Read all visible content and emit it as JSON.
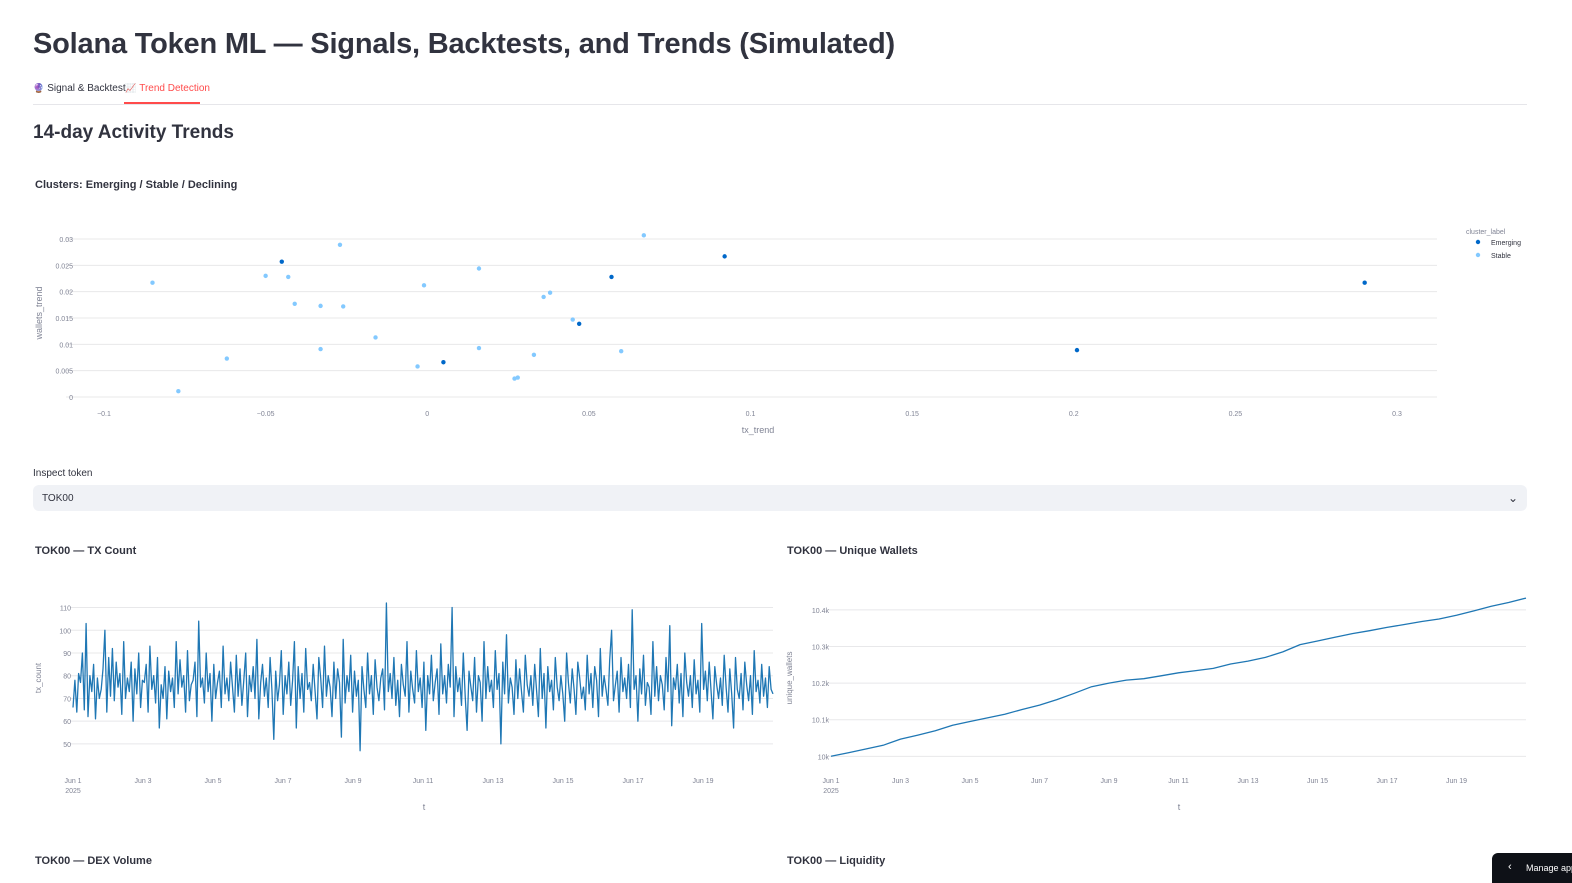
{
  "app": {
    "title": "Solana Token ML — Signals, Backtests, and Trends (Simulated)"
  },
  "tabs": [
    {
      "label": "Signal & Backtest",
      "icon": "crystal-ball-icon",
      "icon_glyph": "🔮"
    },
    {
      "label": "Trend Detection",
      "icon": "chart-increasing-icon",
      "icon_glyph": "📈"
    }
  ],
  "section": {
    "heading": "14-day Activity Trends"
  },
  "colors": {
    "accent": "#ff4b4b",
    "emerging": "#0068c9",
    "stable": "#83c9ff",
    "line": "#1f77b4",
    "grid": "#e8e8ea",
    "axis_text": "#808495"
  },
  "scatter": {
    "title": "Clusters: Emerging / Stable / Declining",
    "legend_title": "cluster_label"
  },
  "inspect": {
    "label": "Inspect token",
    "selected": "TOK00"
  },
  "charts": {
    "tx_title": "TOK00 — TX Count",
    "wallets_title": "TOK00 — Unique Wallets",
    "dex_title": "TOK00 — DEX Volume",
    "liq_title": "TOK00 — Liquidity"
  },
  "manage_app": {
    "label": "Manage app"
  },
  "chart_data": [
    {
      "type": "scatter",
      "title": "Clusters: Emerging / Stable / Declining",
      "xlabel": "tx_trend",
      "ylabel": "wallets_trend",
      "xlim": [
        -0.1,
        0.3
      ],
      "ylim": [
        0,
        0.03
      ],
      "xticks": [
        "−0.1",
        "−0.05",
        "0",
        "0.05",
        "0.1",
        "0.15",
        "0.2",
        "0.25",
        "0.3"
      ],
      "xtick_values": [
        -0.1,
        -0.05,
        0,
        0.05,
        0.1,
        0.15,
        0.2,
        0.25,
        0.3
      ],
      "yticks": [
        "0",
        "0.005",
        "0.01",
        "0.015",
        "0.02",
        "0.025",
        "0.03"
      ],
      "ytick_values": [
        0,
        0.005,
        0.01,
        0.015,
        0.02,
        0.025,
        0.03
      ],
      "legend_position": "top-right",
      "grid": true,
      "series": [
        {
          "name": "Emerging",
          "points": [
            [
              -0.045,
              0.0257
            ],
            [
              0.005,
              0.0066
            ],
            [
              0.057,
              0.0228
            ],
            [
              0.047,
              0.0139
            ],
            [
              0.092,
              0.0267
            ],
            [
              0.201,
              0.0089
            ],
            [
              0.29,
              0.0217
            ]
          ]
        },
        {
          "name": "Stable",
          "points": [
            [
              -0.085,
              0.0217
            ],
            [
              -0.077,
              0.0011
            ],
            [
              -0.062,
              0.0073
            ],
            [
              -0.05,
              0.023
            ],
            [
              -0.043,
              0.0228
            ],
            [
              -0.041,
              0.0177
            ],
            [
              -0.033,
              0.0173
            ],
            [
              -0.033,
              0.0091
            ],
            [
              -0.027,
              0.0289
            ],
            [
              -0.026,
              0.0172
            ],
            [
              -0.016,
              0.0113
            ],
            [
              -0.003,
              0.0058
            ],
            [
              -0.001,
              0.0212
            ],
            [
              0.016,
              0.0093
            ],
            [
              0.016,
              0.0244
            ],
            [
              0.027,
              0.0035
            ],
            [
              0.028,
              0.0037
            ],
            [
              0.033,
              0.008
            ],
            [
              0.036,
              0.019
            ],
            [
              0.038,
              0.0198
            ],
            [
              0.045,
              0.0147
            ],
            [
              0.06,
              0.0087
            ],
            [
              0.067,
              0.0307
            ]
          ]
        }
      ]
    },
    {
      "type": "line",
      "title": "TOK00 — TX Count",
      "xlabel": "t",
      "ylabel": "tx_count",
      "ylim": [
        46,
        112
      ],
      "yticks": [
        "50",
        "60",
        "70",
        "80",
        "90",
        "100",
        "110"
      ],
      "ytick_values": [
        50,
        60,
        70,
        80,
        90,
        100,
        110
      ],
      "xticks": [
        "Jun 1",
        "Jun 3",
        "Jun 5",
        "Jun 7",
        "Jun 9",
        "Jun 11",
        "Jun 13",
        "Jun 15",
        "Jun 17",
        "Jun 19"
      ],
      "xtick_days": [
        0,
        2,
        4,
        6,
        8,
        10,
        12,
        14,
        16,
        18
      ],
      "xtick_sub": "2025",
      "xlim_days": [
        0,
        20
      ],
      "series": [
        {
          "values": [
            66,
            78,
            64,
            81,
            77,
            90,
            65,
            103,
            62,
            80,
            73,
            85,
            61,
            79,
            70,
            74,
            83,
            100,
            64,
            88,
            71,
            92,
            69,
            86,
            75,
            81,
            63,
            95,
            70,
            79,
            73,
            86,
            60,
            83,
            72,
            90,
            66,
            78,
            77,
            85,
            64,
            93,
            74,
            80,
            68,
            88,
            57,
            76,
            70,
            84,
            61,
            82,
            73,
            79,
            66,
            95,
            72,
            87,
            75,
            80,
            64,
            91,
            69,
            76,
            78,
            86,
            62,
            104,
            75,
            79,
            68,
            90,
            73,
            81,
            60,
            85,
            70,
            77,
            82,
            66,
            93,
            72,
            79,
            69,
            86,
            75,
            64,
            89,
            71,
            83,
            67,
            78,
            90,
            62,
            80,
            73,
            84,
            70,
            96,
            61,
            77,
            85,
            71,
            79,
            66,
            88,
            74,
            52,
            82,
            69,
            76,
            91,
            63,
            80,
            72,
            86,
            67,
            78,
            95,
            57,
            84,
            70,
            81,
            64,
            92,
            74,
            77,
            69,
            85,
            73,
            61,
            88,
            79,
            66,
            93,
            71,
            80,
            75,
            62,
            86,
            70,
            83,
            77,
            53,
            96,
            68,
            80,
            73,
            89,
            64,
            82,
            71,
            78,
            47,
            84,
            74,
            66,
            90,
            72,
            80,
            63,
            87,
            75,
            69,
            79,
            83,
            65,
            112,
            73,
            81,
            70,
            88,
            67,
            78,
            62,
            85,
            76,
            71,
            95,
            64,
            82,
            74,
            68,
            91,
            73,
            79,
            66,
            86,
            56,
            80,
            72,
            89,
            69,
            77,
            83,
            63,
            94,
            72,
            80,
            68,
            85,
            75,
            110,
            62,
            84,
            73,
            79,
            67,
            90,
            71,
            56,
            82,
            75,
            69,
            88,
            64,
            80,
            77,
            60,
            95,
            70,
            84,
            73,
            78,
            66,
            91,
            74,
            81,
            50,
            86,
            72,
            98,
            68,
            79,
            75,
            63,
            87,
            70,
            83,
            73,
            64,
            89,
            76,
            71,
            80,
            67,
            85,
            74,
            62,
            92,
            70,
            81,
            57,
            84,
            73,
            78,
            65,
            88,
            75,
            69,
            80,
            72,
            60,
            90,
            77,
            68,
            83,
            74,
            63,
            86,
            79,
            70,
            75,
            65,
            89,
            72,
            81,
            66,
            84,
            78,
            62,
            92,
            71,
            80,
            74,
            67,
            87,
            100,
            69,
            76,
            82,
            64,
            88,
            73,
            79,
            70,
            85,
            66,
            109,
            74,
            80,
            60,
            83,
            72,
            89,
            67,
            77,
            75,
            63,
            95,
            71,
            84,
            69,
            80,
            76,
            65,
            88,
            73,
            102,
            58,
            79,
            74,
            85,
            68,
            81,
            62,
            90,
            77,
            71,
            80,
            66,
            87,
            72,
            78,
            64,
            103,
            74,
            82,
            69,
            86,
            73,
            61,
            84,
            76,
            70,
            79,
            67,
            89,
            75,
            64,
            83,
            72,
            57,
            88,
            74,
            70,
            81,
            65,
            86,
            76,
            69,
            80,
            63,
            91,
            73,
            78,
            68,
            85,
            71,
            79,
            66,
            84,
            74,
            72
          ]
        }
      ]
    },
    {
      "type": "line",
      "title": "TOK00 — Unique Wallets",
      "xlabel": "t",
      "ylabel": "unique_wallets",
      "ylim": [
        9990,
        10435
      ],
      "yticks": [
        "10k",
        "10.1k",
        "10.2k",
        "10.3k",
        "10.4k"
      ],
      "ytick_values": [
        10000,
        10100,
        10200,
        10300,
        10400
      ],
      "xticks": [
        "Jun 1",
        "Jun 3",
        "Jun 5",
        "Jun 7",
        "Jun 9",
        "Jun 11",
        "Jun 13",
        "Jun 15",
        "Jun 17",
        "Jun 19"
      ],
      "xtick_days": [
        0,
        2,
        4,
        6,
        8,
        10,
        12,
        14,
        16,
        18
      ],
      "xtick_sub": "2025",
      "xlim_days": [
        0,
        20
      ],
      "series": [
        {
          "x_days": [
            0,
            0.5,
            1,
            1.5,
            2,
            2.5,
            3,
            3.5,
            4,
            4.5,
            5,
            5.5,
            6,
            6.5,
            7,
            7.5,
            8,
            8.5,
            9,
            9.5,
            10,
            10.5,
            11,
            11.5,
            12,
            12.5,
            13,
            13.5,
            14,
            14.5,
            15,
            15.5,
            16,
            16.5,
            17,
            17.5,
            18,
            18.5,
            19,
            19.5,
            20
          ],
          "values": [
            10000,
            10010,
            10020,
            10030,
            10047,
            10058,
            10070,
            10085,
            10095,
            10105,
            10115,
            10128,
            10140,
            10155,
            10172,
            10190,
            10200,
            10208,
            10212,
            10220,
            10228,
            10234,
            10240,
            10252,
            10260,
            10270,
            10285,
            10305,
            10315,
            10325,
            10335,
            10343,
            10352,
            10360,
            10368,
            10375,
            10385,
            10397,
            10410,
            10420,
            10432
          ]
        }
      ]
    }
  ]
}
